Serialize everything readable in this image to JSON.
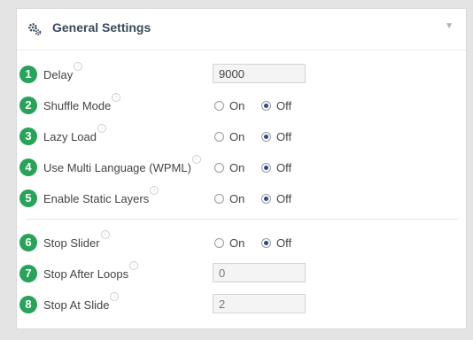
{
  "panel": {
    "title": "General Settings",
    "header_icon": "gears-icon",
    "collapse_icon": "triangle-down-icon",
    "collapse_glyph": "▼"
  },
  "rows": [
    {
      "num": "1",
      "label": "Delay",
      "type": "text",
      "value": "9000"
    },
    {
      "num": "2",
      "label": "Shuffle Mode",
      "type": "radio",
      "on": "On",
      "off": "Off",
      "selected": "Off"
    },
    {
      "num": "3",
      "label": "Lazy Load",
      "type": "radio",
      "on": "On",
      "off": "Off",
      "selected": "Off"
    },
    {
      "num": "4",
      "label": "Use Multi Language (WPML)",
      "type": "radio",
      "on": "On",
      "off": "Off",
      "selected": "Off"
    },
    {
      "num": "5",
      "label": "Enable Static Layers",
      "type": "radio",
      "on": "On",
      "off": "Off",
      "selected": "Off"
    },
    {
      "num": "6",
      "label": "Stop Slider",
      "type": "radio",
      "on": "On",
      "off": "Off",
      "selected": "Off"
    },
    {
      "num": "7",
      "label": "Stop After Loops",
      "type": "text",
      "value": "0"
    },
    {
      "num": "8",
      "label": "Stop At Slide",
      "type": "text",
      "value": "2"
    }
  ],
  "colors": {
    "badge": "#27a35a",
    "radio_checked": "#2b4a8c",
    "title": "#3a4a5b"
  }
}
